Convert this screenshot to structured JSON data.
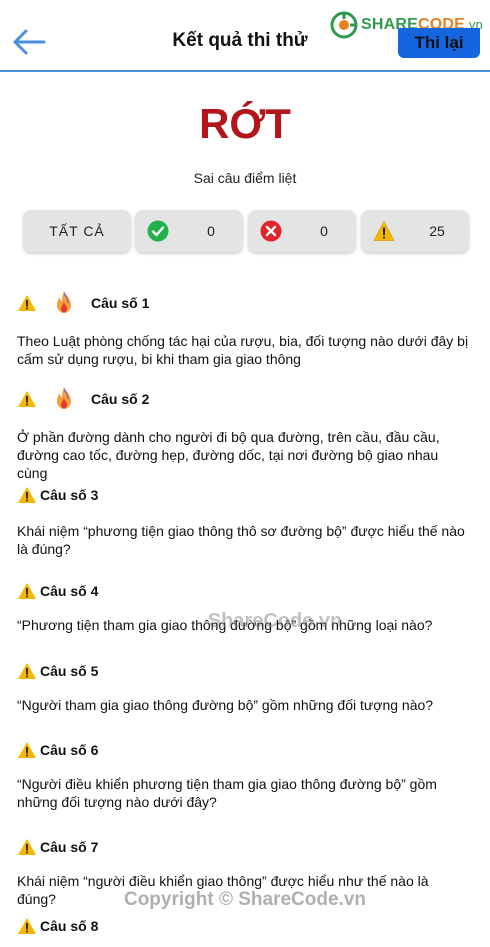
{
  "header": {
    "title": "Kết quả thi thử",
    "retry_label": "Thi lại",
    "logo_text_a": "SHARE",
    "logo_text_b": "CODE",
    "logo_text_c": ".vn"
  },
  "result": {
    "status": "RỚT",
    "reason": "Sai câu điểm liệt"
  },
  "filters": {
    "all_label": "TẤT CẢ",
    "correct_count": "0",
    "wrong_count": "0",
    "unanswered_count": "25"
  },
  "questions": [
    {
      "title": "Câu số 1",
      "text": "Theo Luật phòng chống tác hại của rượu, bia, đối tượng nào dưới đây bị cấm sử dụng rượu, bi khi tham gia giao thông",
      "critical": true
    },
    {
      "title": "Câu số 2",
      "text": "Ở phần đường dành cho người đi bộ qua đường, trên cầu, đầu cầu, đường cao tốc, đường hẹp, đường dốc, tại nơi đường bộ giao nhau cùng",
      "critical": true
    },
    {
      "title": "Câu số 3",
      "text": "Khái niệm “phương tiện giao thông thô sơ đường bộ” được hiểu thế nào là đúng?",
      "critical": false
    },
    {
      "title": "Câu số 4",
      "text": "“Phương tiện tham gia giao thông đường bộ” gồm những loại nào?",
      "critical": false
    },
    {
      "title": "Câu số 5",
      "text": "“Người tham gia giao thông đường bộ” gồm những đối tượng nào?",
      "critical": false
    },
    {
      "title": "Câu số 6",
      "text": "“Người điều khiển phương tiện tham gia giao thông đường bộ” gồm những đối tượng nào dưới đây?",
      "critical": false
    },
    {
      "title": "Câu số 7",
      "text": "Khái niệm “người điều khiển giao thông” được hiểu như thế nào là đúng?",
      "critical": false
    },
    {
      "title": "Câu số 8",
      "text": "",
      "critical": false
    }
  ],
  "watermarks": {
    "middle": "ShareCode.vn",
    "bottom": "Copyright © ShareCode.vn"
  },
  "colors": {
    "accent": "#1565e0",
    "fail": "#b2161b",
    "correct": "#22b04b",
    "wrong": "#e0242b",
    "warning": "#f5b800"
  }
}
